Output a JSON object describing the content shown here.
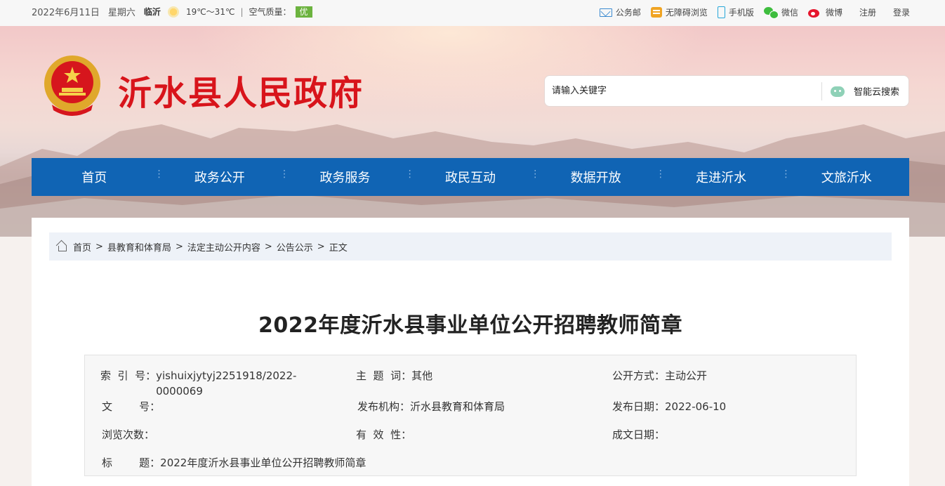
{
  "topbar": {
    "date": "2022年6月11日",
    "weekday": "星期六",
    "city": "临沂",
    "temperature": "19℃～31℃",
    "separator": "|",
    "air_quality_label": "空气质量：",
    "air_quality_value": "优",
    "links": {
      "mail": "公务邮",
      "accessible": "无障碍浏览",
      "mobile": "手机版",
      "wechat": "微信",
      "weibo": "微博",
      "register": "注册",
      "login": "登录"
    }
  },
  "header": {
    "site_title": "沂水县人民政府",
    "search_placeholder": "请输入关键字",
    "search_button": "智能云搜索"
  },
  "nav": {
    "items": [
      "首页",
      "政务公开",
      "政务服务",
      "政民互动",
      "数据开放",
      "走进沂水",
      "文旅沂水"
    ]
  },
  "breadcrumb": {
    "items": [
      "首页",
      "县教育和体育局",
      "法定主动公开内容",
      "公告公示",
      "正文"
    ],
    "separator": ">"
  },
  "article": {
    "title": "2022年度沂水县事业单位公开招聘教师简章"
  },
  "meta": {
    "index_label": "索  引  号：",
    "index_value_line1": "yishuixjytyj2251918/2022-",
    "index_value_line2": "0000069",
    "topic_label": "主  题  词：",
    "topic_value": "其他",
    "mode_label": "公开方式：",
    "mode_value": "主动公开",
    "docno_label": "文        号：",
    "docno_value": "",
    "org_label": "发布机构：",
    "org_value": "沂水县教育和体育局",
    "pubdate_label": "发布日期：",
    "pubdate_value": "2022-06-10",
    "views_label": "浏览次数：",
    "views_value": "",
    "validity_label": "有  效  性：",
    "validity_value": "",
    "written_label": "成文日期：",
    "written_value": "",
    "title_label": "标        题：",
    "title_value": "2022年度沂水县事业单位公开招聘教师简章"
  },
  "colors": {
    "nav_bg": "#1064b4",
    "site_title": "#d8141b",
    "aqi_badge": "#6cb33f",
    "breadcrumb_bg": "#eef2f8"
  }
}
